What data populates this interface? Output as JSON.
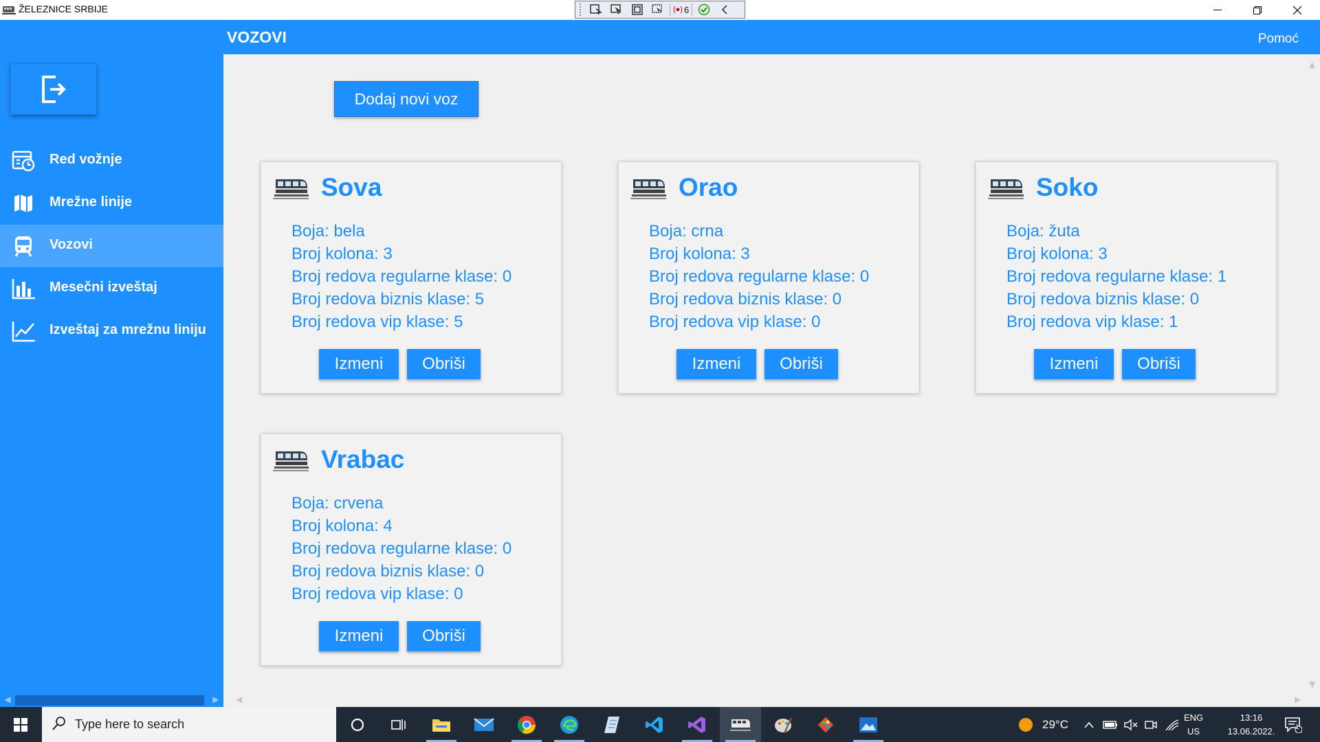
{
  "window": {
    "title": "ŽELEZNICE SRBIJE",
    "debug_toolbar": {
      "count": "6"
    }
  },
  "header": {
    "title": "VOZOVI",
    "help_label": "Pomoć"
  },
  "sidebar": {
    "items": [
      {
        "label": "Red vožnje",
        "icon": "timetable-icon",
        "active": false
      },
      {
        "label": "Mrežne linije",
        "icon": "map-icon",
        "active": false
      },
      {
        "label": "Vozovi",
        "icon": "train-icon",
        "active": true
      },
      {
        "label": "Mesečni izveštaj",
        "icon": "bar-chart-icon",
        "active": false
      },
      {
        "label": "Izveštaj za mrežnu liniju",
        "icon": "line-chart-icon",
        "active": false
      }
    ]
  },
  "main": {
    "add_button_label": "Dodaj novi voz",
    "trains": [
      {
        "name": "Sova",
        "props": [
          "Boja: bela",
          "Broj kolona: 3",
          "Broj redova regularne klase: 0",
          "Broj redova biznis klase: 5",
          "Broj redova vip klase: 5"
        ],
        "edit_label": "Izmeni",
        "delete_label": "Obriši"
      },
      {
        "name": "Orao",
        "props": [
          "Boja: crna",
          "Broj kolona: 3",
          "Broj redova regularne klase: 0",
          "Broj redova biznis klase: 0",
          "Broj redova vip klase: 0"
        ],
        "edit_label": "Izmeni",
        "delete_label": "Obriši"
      },
      {
        "name": "Soko",
        "props": [
          "Boja: žuta",
          "Broj kolona: 3",
          "Broj redova regularne klase: 1",
          "Broj redova biznis klase: 0",
          "Broj redova vip klase: 1"
        ],
        "edit_label": "Izmeni",
        "delete_label": "Obriši"
      },
      {
        "name": "Vrabac",
        "props": [
          "Boja: crvena",
          "Broj kolona: 4",
          "Broj redova regularne klase: 0",
          "Broj redova biznis klase: 0",
          "Broj redova vip klase: 0"
        ],
        "edit_label": "Izmeni",
        "delete_label": "Obriši"
      }
    ]
  },
  "taskbar": {
    "search_placeholder": "Type here to search",
    "temperature": "29°C",
    "lang_top": "ENG",
    "lang_bottom": "US",
    "time": "13:16",
    "date": "13.06.2022.",
    "notification_count": "1"
  },
  "colors": {
    "accent": "#1e8fff",
    "active_nav": "#4aa5ff",
    "taskbar": "#1f2a36"
  }
}
